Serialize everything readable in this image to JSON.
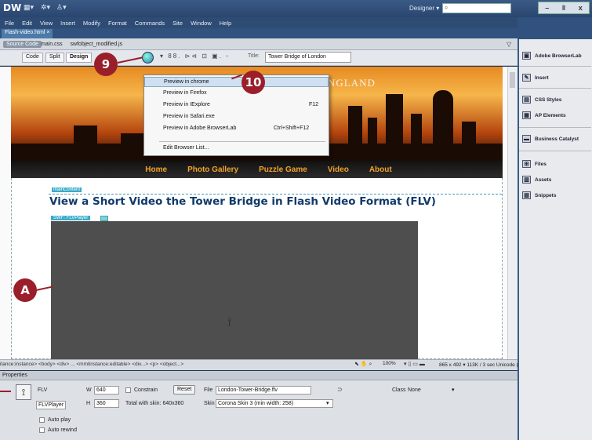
{
  "app": {
    "logo": "DW",
    "workspace": "Designer",
    "window_controls": {
      "minimize": "–",
      "restore": "ǁ",
      "close": "x"
    }
  },
  "menu": [
    "File",
    "Edit",
    "View",
    "Insert",
    "Modify",
    "Format",
    "Commands",
    "Site",
    "Window",
    "Help"
  ],
  "document": {
    "tab": "Flash-video.html",
    "tab_close": "×",
    "source_code": "Source Code",
    "related_files": "main.css   swfobject_modified.js",
    "views": [
      "Code",
      "Split",
      "Design"
    ],
    "title_label": "Title:",
    "title_value": "Tower Bridge of London"
  },
  "page": {
    "banner_text": "NGLAND",
    "nav": [
      "Home",
      "Photo Gallery",
      "Puzzle Game",
      "Video",
      "About"
    ],
    "region_tag": "mainContent",
    "headline": "View a Short Video the Tower Bridge in Flash Video Format (FLV)",
    "swf_tag": "SWF: FLVPlayer"
  },
  "preview_menu": {
    "items": [
      {
        "label": "Preview in chrome",
        "shortcut": ""
      },
      {
        "label": "Preview in Firefox",
        "shortcut": ""
      },
      {
        "label": "Preview in IExplore",
        "shortcut": "F12"
      },
      {
        "label": "Preview in Safari.exe",
        "shortcut": ""
      },
      {
        "label": "Preview in Adobe BrowserLab",
        "shortcut": "Ctrl+Shift+F12"
      },
      {
        "label": "Edit Browser List...",
        "shortcut": ""
      }
    ]
  },
  "status_bar": {
    "tag_path": "itance:instance> <body> <div> ... <mmtinstance:editable> <div...> <p> <object...>",
    "zoom": "100%",
    "info": "865 x 492 ▾  113K / 3 sec  Unicode (UTF-8)"
  },
  "properties": {
    "title": "Properties",
    "type": "FLV",
    "name": "FLVPlayer",
    "w_label": "W",
    "w_value": "640",
    "h_label": "H",
    "h_value": "360",
    "constrain": "Constrain",
    "reset": "Reset",
    "skin_total": "Total with skin: 640x360",
    "file_label": "File",
    "file_value": "London-Tower-Bridge.flv",
    "skin_label": "Skin",
    "skin_value": "Corona Skin 3 (min width: 258)",
    "class_label": "Class",
    "class_value": "None",
    "auto_play": "Auto play",
    "auto_rewind": "Auto rewind"
  },
  "panels": [
    "Adobe BrowserLab",
    "Insert",
    "CSS Styles",
    "AP Elements",
    "Business Catalyst",
    "Files",
    "Assets",
    "Snippets"
  ],
  "callouts": {
    "nine": "9",
    "ten": "10",
    "a": "A"
  }
}
